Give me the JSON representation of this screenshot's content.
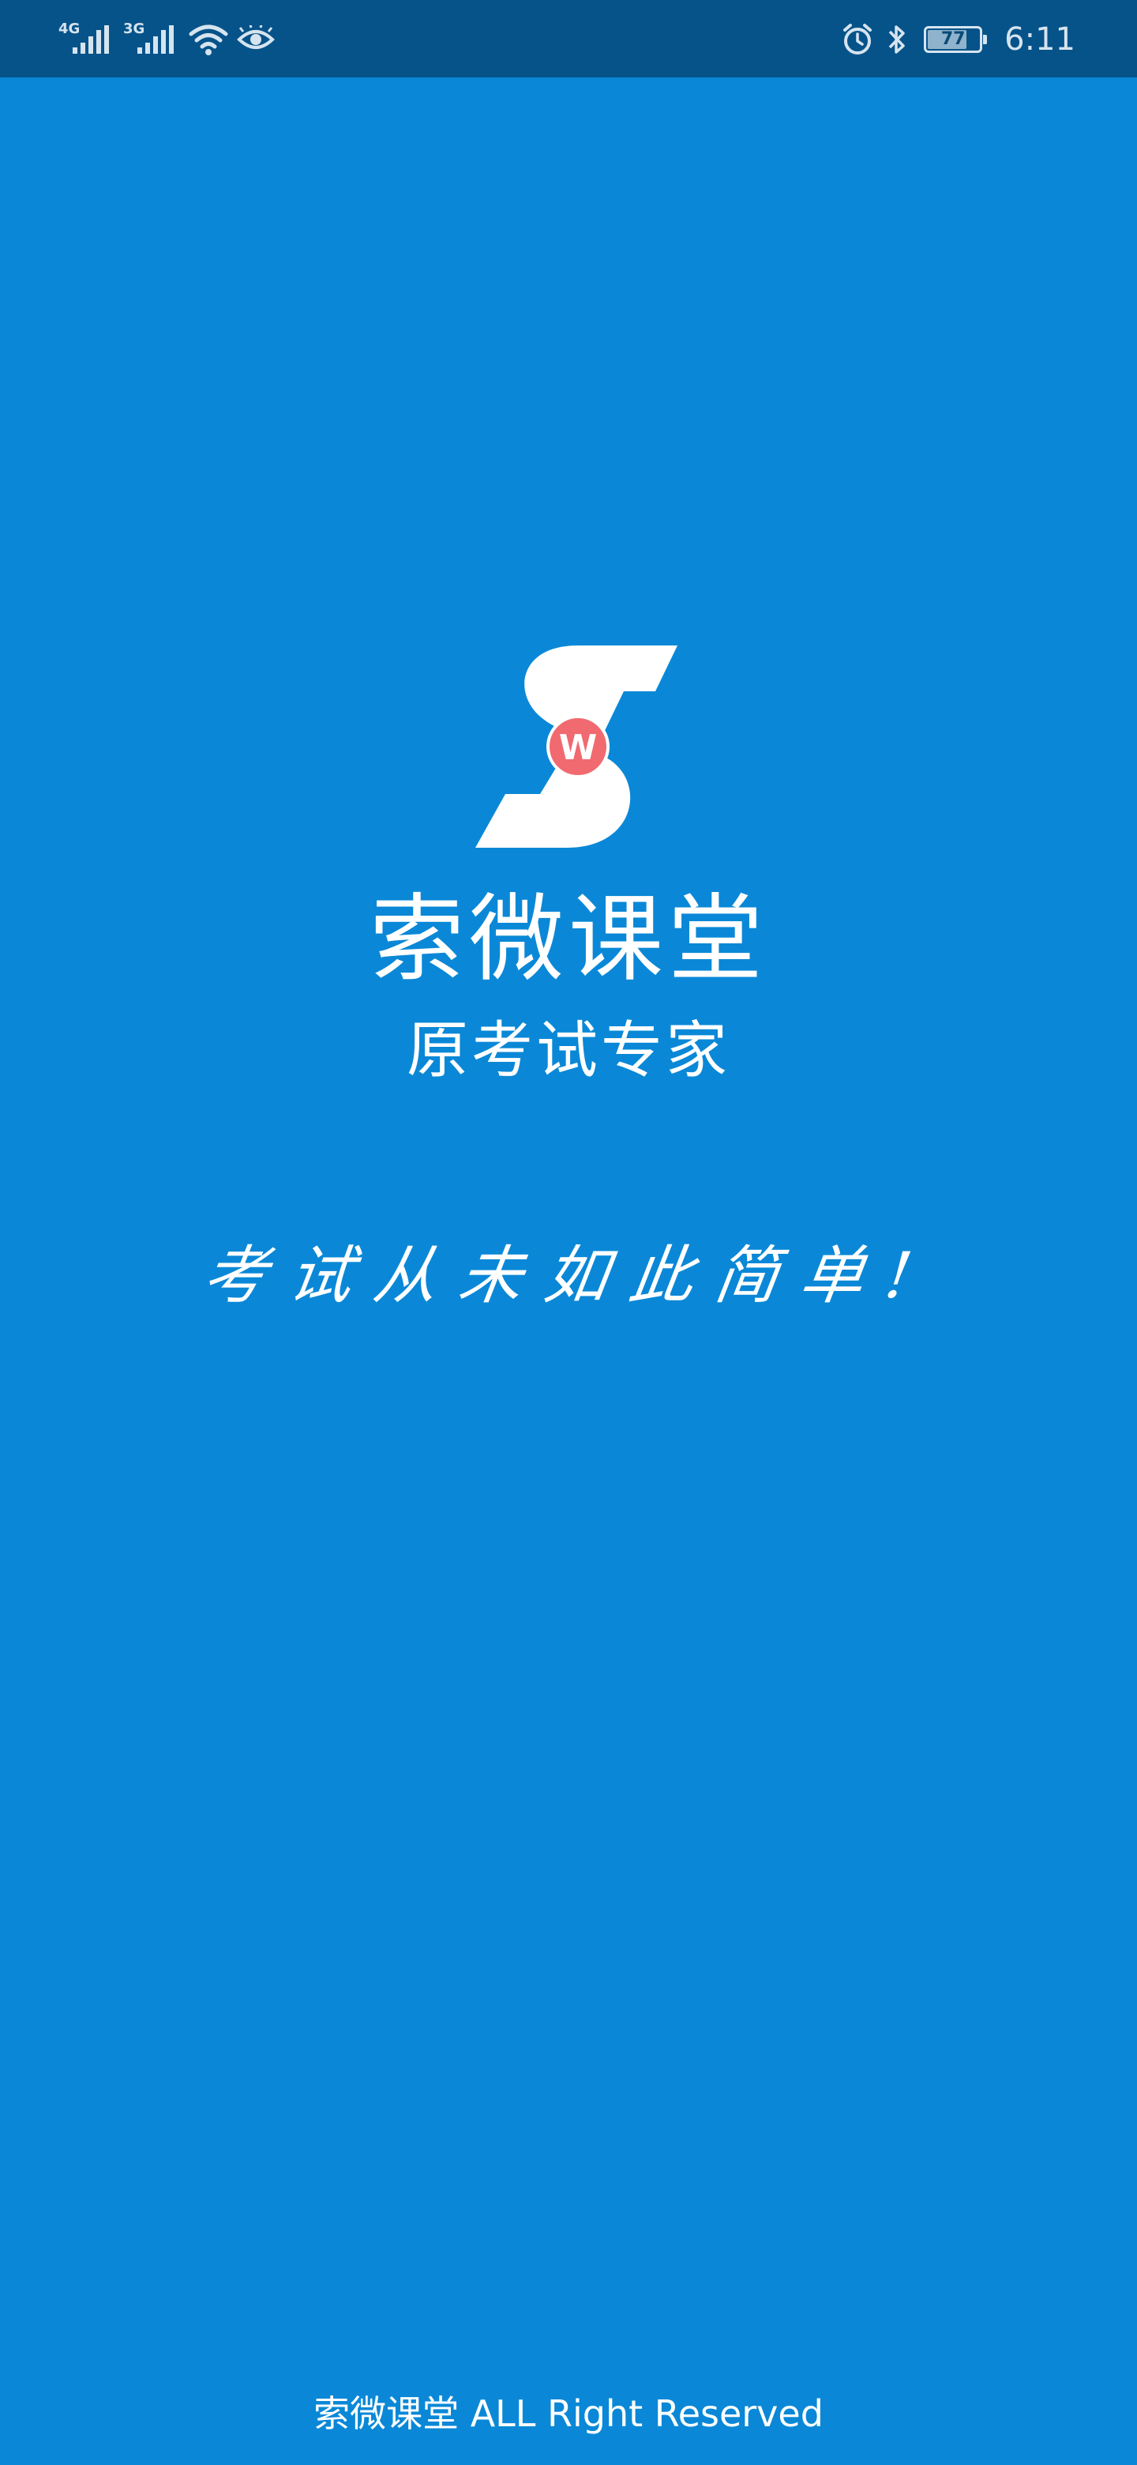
{
  "status_bar": {
    "network_1": "4G",
    "network_2": "3G",
    "battery_level": "77",
    "battery_percent": 77,
    "time": "6:11",
    "icons": [
      "signal-icon",
      "wifi-icon",
      "eye-icon",
      "alarm-icon",
      "bluetooth-icon",
      "battery-icon"
    ]
  },
  "splash": {
    "logo_letter": "W",
    "brand_name": "索微课堂",
    "tagline": "原考试专家",
    "slogan": "考试从未如此简单!",
    "copyright": "索微课堂 ALL Right Reserved"
  },
  "colors": {
    "background": "#0a88d7",
    "status_bar": "#06538a",
    "logo_badge": "#f06a6f",
    "text": "#ffffff"
  }
}
